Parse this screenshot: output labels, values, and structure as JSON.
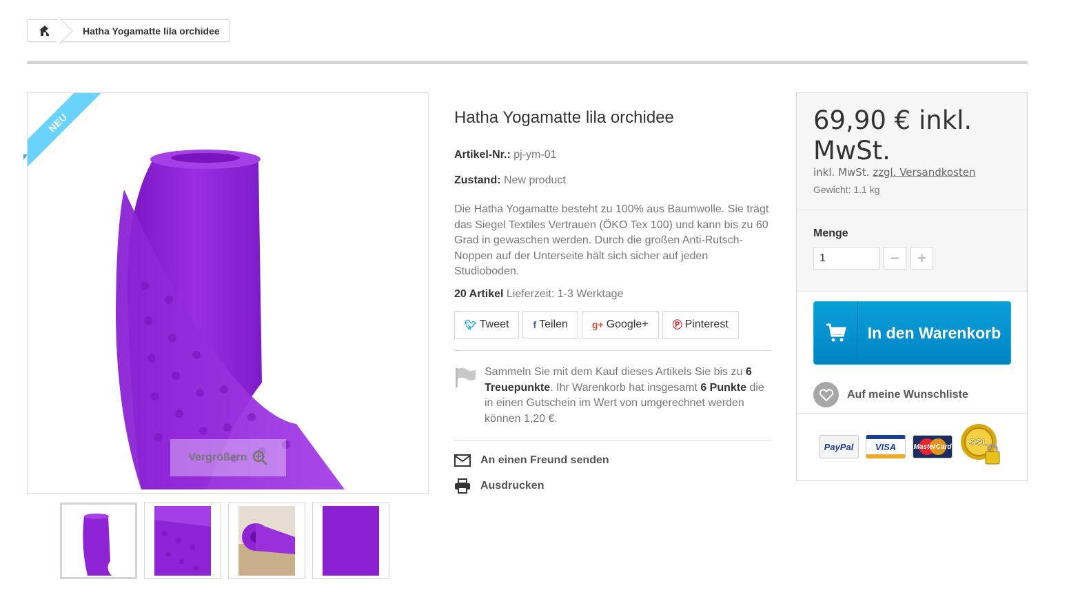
{
  "breadcrumb": {
    "home_icon": "home-icon",
    "current": "Hatha Yogamatte lila orchidee"
  },
  "gallery": {
    "ribbon": "NEU",
    "zoom_label": "Vergrößern",
    "zoom_icon": "zoom-in-icon",
    "accent_color": "#8f24d6",
    "thumbnails": [
      "roll",
      "texture",
      "rolled-mat",
      "surface"
    ]
  },
  "product": {
    "title": "Hatha Yogamatte lila orchidee",
    "reference_label": "Artikel-Nr.:",
    "reference_value": "pj-ym-01",
    "condition_label": "Zustand:",
    "condition_value": "New product",
    "description": "Die Hatha Yogamatte besteht zu 100% aus Baumwolle. Sie trägt das Siegel Textiles Vertrauen (ÖKO Tex 100) und kann bis zu 60 Grad in gewaschen werden. Durch die großen Anti-Rutsch-Noppen auf der Unterseite hält sich sicher auf jeden Studioboden.",
    "stock_count": "20 Artikel",
    "stock_delivery": "Lieferzeit: 1-3 Werktage"
  },
  "social": {
    "tweet": "Tweet",
    "share": "Teilen",
    "google": "Google+",
    "pinterest": "Pinterest"
  },
  "loyalty": {
    "part1": "Sammeln Sie mit dem Kauf dieses Artikels Sie bis zu ",
    "points1": "6 Treuepunkte",
    "part2": ". Ihr Warenkorb hat insgesamt ",
    "points2": "6 Punkte",
    "part3": " die in einen Gutschein im Wert von umgerechnet werden können 1,20 €."
  },
  "actions": {
    "send_friend": "An einen Freund senden",
    "print": "Ausdrucken"
  },
  "buybox": {
    "price": "69,90 € inkl. MwSt.",
    "tax_note": "inkl. MwSt.",
    "shipping_link": "zzgl. Versandkosten",
    "weight": "Gewicht: 1.1 kg",
    "quantity_label": "Menge",
    "quantity_value": "1",
    "minus": "−",
    "plus": "+",
    "cart_label": "In den Warenkorb",
    "wishlist_label": "Auf meine Wunschliste",
    "payments": {
      "paypal": "PayPal",
      "visa": "VISA",
      "mastercard": "MasterCard",
      "ssl": "SSL"
    },
    "cart_color": "#0aa0d8"
  }
}
